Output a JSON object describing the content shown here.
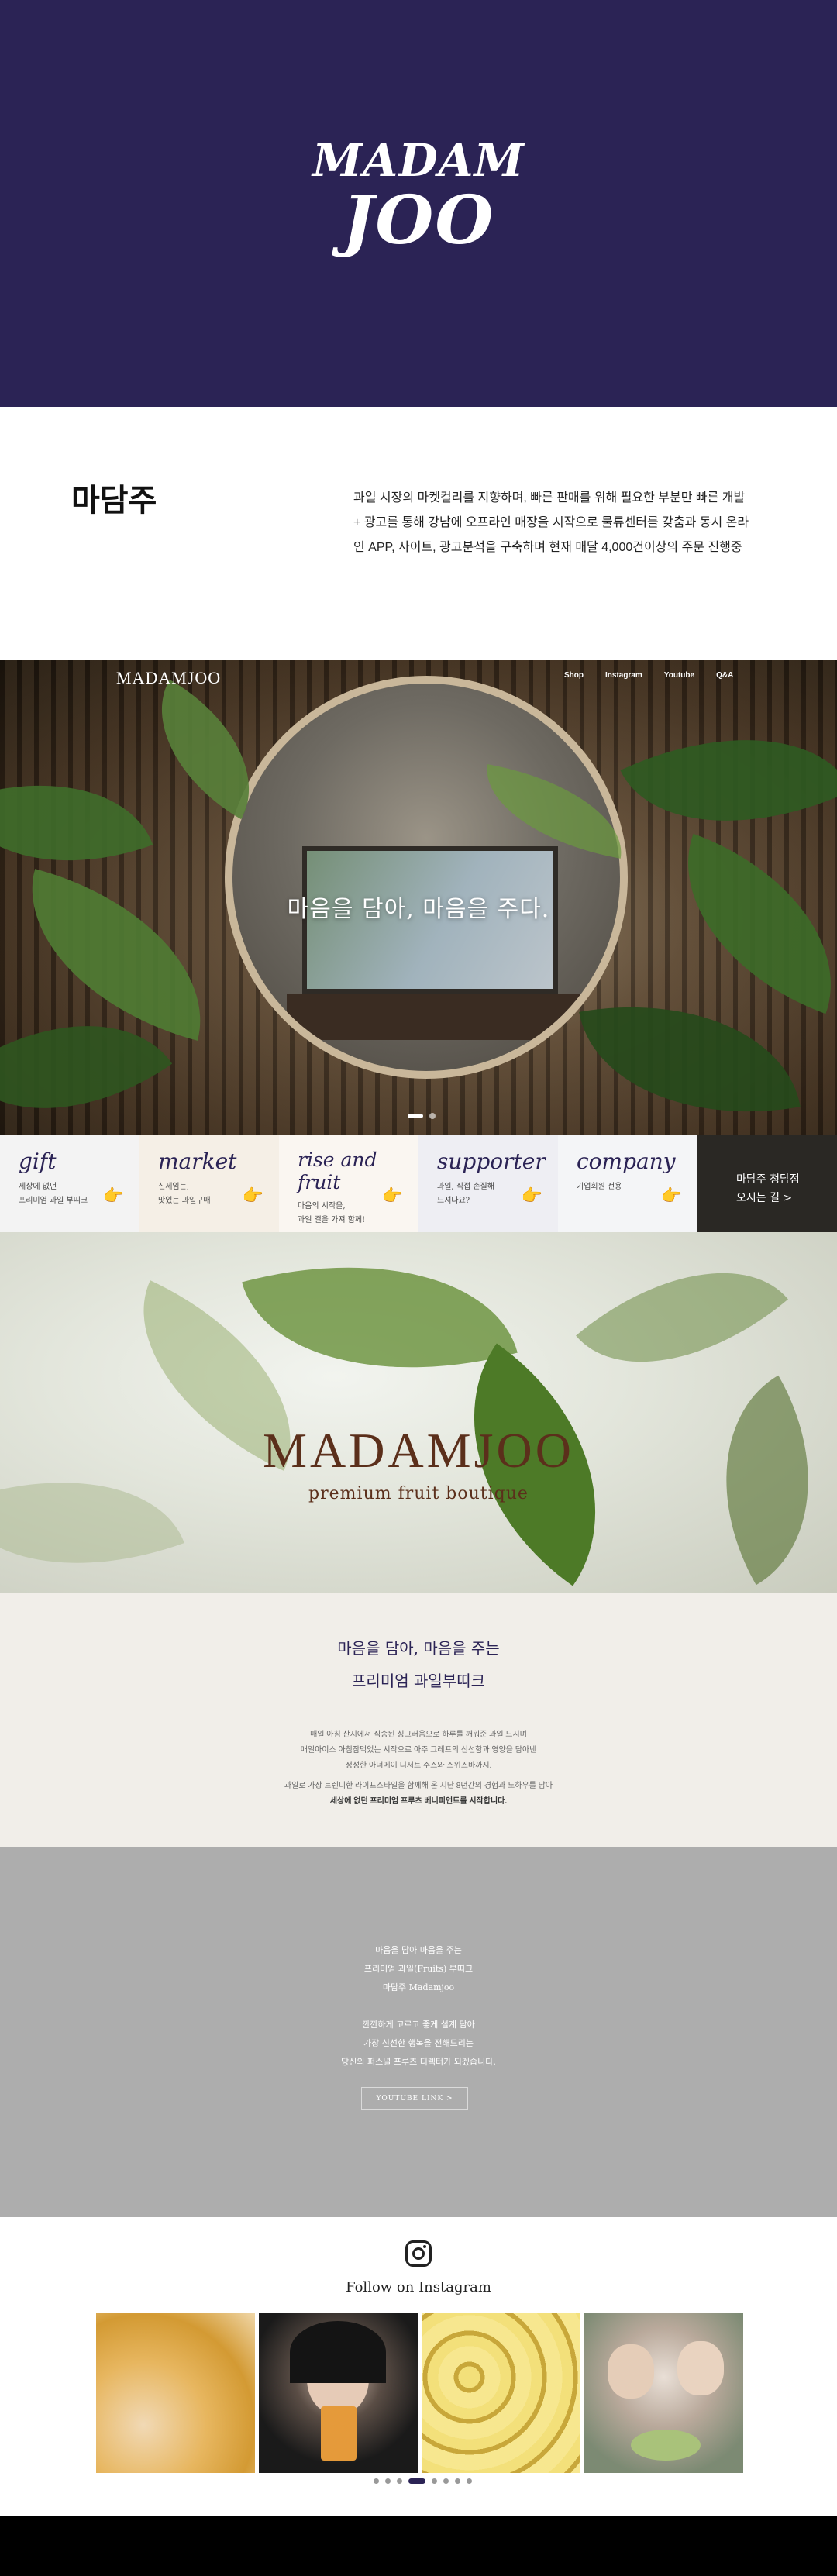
{
  "hero": {
    "logo_line1": "MADAM",
    "logo_line2": "JOO",
    "bg_color": "#2b2355"
  },
  "intro": {
    "title": "마담주",
    "text_line1": "과일 시장의 마켓컬리를 지향하며, 빠른 판매를 위해 필요한 부분만 빠른 개발",
    "text_line2": "+ 광고를 통해 강남에 오프라인 매장을 시작으로 물류센터를 갖춤과 동시 온라",
    "text_line3": "인 APP, 사이트, 광고분석을 구축하며 현재 매달 4,000건이상의 주문 진행중"
  },
  "photo_hero": {
    "nav_logo": "MADAMJOO",
    "nav_links": [
      "Shop",
      "Instagram",
      "Youtube",
      "Q&A"
    ],
    "slogan": "마음을 담아, 마음을 주다."
  },
  "cards": [
    {
      "title": "gift",
      "sub1": "세상에 없던",
      "sub2": "프리미엄 과일 부띠크",
      "bg": "#f3f3f3"
    },
    {
      "title": "market",
      "sub1": "신세임는,",
      "sub2": "맛있는 과일구매",
      "bg": "#f5efe6"
    },
    {
      "title": "rise and fruit",
      "sub1": "마음의 시작을,",
      "sub2": "과일 결을 가져 함께!",
      "bg": "#faf6f1"
    },
    {
      "title": "supporter",
      "sub1": "과일, 직접 손질해",
      "sub2": "드셔나요?",
      "bg": "#eeeef3"
    },
    {
      "title": "company",
      "sub1": "기업회원 전용",
      "sub2": "",
      "bg": "#f4f5f7"
    }
  ],
  "dark_card": {
    "line1": "마담주 청담점",
    "line2": "오시는 길 >"
  },
  "boutique": {
    "title": "MADAMJOO",
    "subtitle": "premium fruit boutique"
  },
  "about": {
    "heading1": "마음을 담아, 마음을 주는",
    "heading2": "프리미엄 과일부띠크",
    "p1_line1": "매일 아침 산지에서 직송된 싱그러움으로 하루를 깨워준 과일 드시며",
    "p1_line2": "매일아이스 아침잠먹었는 시작으로 아주 그레프의 신선함과 영양을 담아낸",
    "p1_line3": "정성한 아너메이 디저트 주스와 스위즈바까지.",
    "p2_line1": "과일로 가장 트렌디한 라이프스타일을 함께해 온 지난 8년간의 경험과 노하우를 담아",
    "p2_line2": "세상에 없던 프리미엄 프루츠 베니피언트를 시작합니다."
  },
  "video": {
    "l1": "마음을 담아 마음을 주는",
    "l2": "프리미엄 과일(Fruits) 부띠크",
    "l3": "마담주 Madamjoo",
    "l4": "깐깐하게 고르고 좋게 설계 담아",
    "l5": "가장 신선한 행복을 전해드리는",
    "l6": "당신의 퍼스널 프루츠 디렉터가 되겠습니다.",
    "button": "YOUTUBE LINK >"
  },
  "instagram": {
    "title": "Follow on Instagram",
    "thumbs": [
      "peach-photo",
      "woman-juice-photo",
      "mango-photo",
      "two-women-grapes-photo"
    ],
    "page_count": 8,
    "active_page": 4
  },
  "colors": {
    "brand_purple": "#2b2355",
    "brown": "#5b2f1b",
    "beige": "#f1eee9",
    "gray": "#adadad"
  }
}
